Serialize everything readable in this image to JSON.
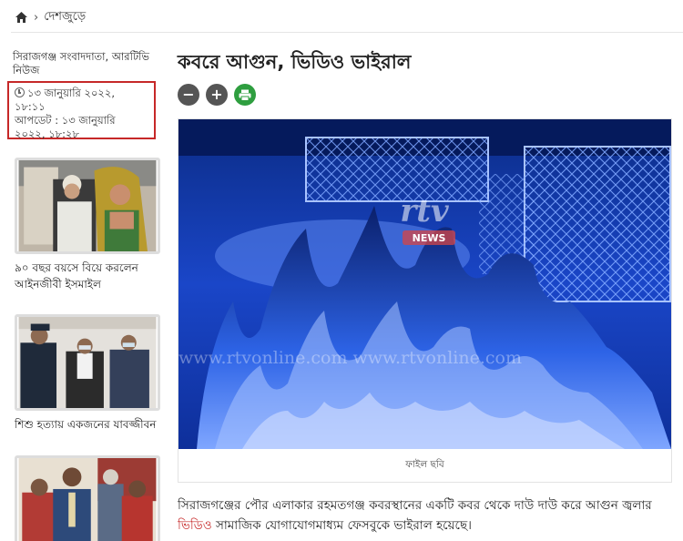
{
  "breadcrumb": {
    "section": "দেশজুড়ে"
  },
  "sidebar": {
    "author": "সিরাজগঞ্জ সংবাদদাতা, আরটিভি নিউজ",
    "published": "১৩ জানুয়ারি ২০২২, ১৮:১১",
    "updated": "আপডেট : ১৩ জানুয়ারি ২০২২, ১৮:২৮",
    "related": [
      {
        "title": "৯০ বছর বয়সে বিয়ে করলেন আইনজীবী ইসমাইল"
      },
      {
        "title": "শিশু হত্যায় একজনের যাবজ্জীবন"
      }
    ]
  },
  "article": {
    "headline": "কবরে আগুন, ভিডিও ভাইরাল",
    "tools": {
      "decrease": "−",
      "increase": "+"
    },
    "image": {
      "logo_text": "rtv",
      "logo_badge": "NEWS",
      "watermark": "www.rtvonline.com   www.rtvonline.com"
    },
    "caption": "ফাইল ছবি",
    "body_before": "সিরাজগঞ্জের পৌর এলাকার রহমতগঞ্জ কবরস্থানের একটি কবর থেকে দাউ দাউ করে আগুন জ্বলার",
    "body_link": "ভিডিও",
    "body_after": " সামাজিক যোগাযোগমাধ্যম ফেসবুকে ভাইরাল হয়েছে।"
  },
  "colors": {
    "accent_red": "#c62828",
    "print_green": "#2e9e3f",
    "tool_dark": "#555555",
    "image_blue": "#1e4fd6"
  }
}
